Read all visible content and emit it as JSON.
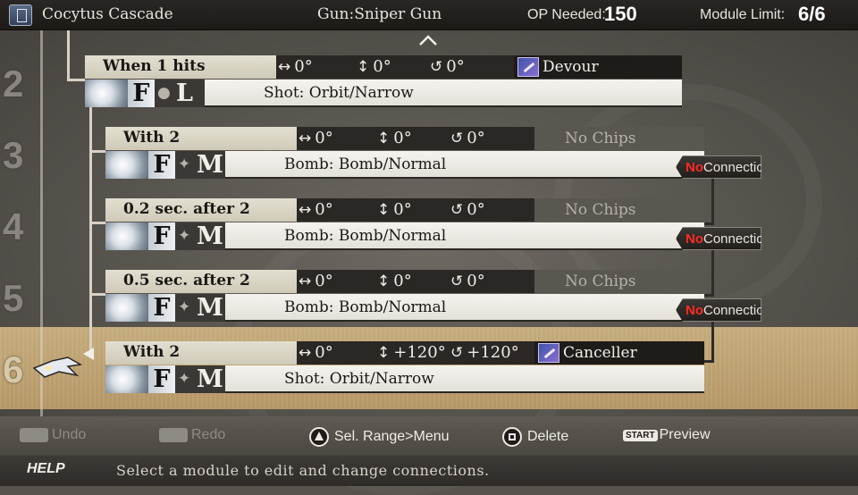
{
  "header": {
    "bullet_name": "Cocytus Cascade",
    "gun": "Gun:Sniper Gun",
    "op_label": "OP Needed:",
    "op_value": "150",
    "module_label": "Module  Limit:",
    "module_value": "6/6",
    "icon": "book-icon"
  },
  "rows": [
    {
      "num": "2",
      "trigger": "When 1 hits",
      "angle_h": "0°",
      "angle_v": "0°",
      "angle_r": "0°",
      "chip": "Devour",
      "chip_set": true,
      "element": "F",
      "letter": "L",
      "shot": "Shot: Orbit/Narrow",
      "connection": null
    },
    {
      "num": "3",
      "trigger": "With 2",
      "angle_h": "0°",
      "angle_v": "0°",
      "angle_r": "0°",
      "chip": "No Chips",
      "chip_set": false,
      "element": "F",
      "letter": "M",
      "shot": "Bomb: Bomb/Normal",
      "connection": {
        "no": "No",
        "text": "Connection"
      }
    },
    {
      "num": "4",
      "trigger": "0.2 sec. after 2",
      "angle_h": "0°",
      "angle_v": "0°",
      "angle_r": "0°",
      "chip": "No Chips",
      "chip_set": false,
      "element": "F",
      "letter": "M",
      "shot": "Bomb: Bomb/Normal",
      "connection": {
        "no": "No",
        "text": "Connection"
      }
    },
    {
      "num": "5",
      "trigger": "0.5 sec. after 2",
      "angle_h": "0°",
      "angle_v": "0°",
      "angle_r": "0°",
      "chip": "No Chips",
      "chip_set": false,
      "element": "F",
      "letter": "M",
      "shot": "Bomb: Bomb/Normal",
      "connection": {
        "no": "No",
        "text": "Connection"
      }
    },
    {
      "num": "6",
      "trigger": "With 2",
      "angle_h": "0°",
      "angle_v": "+120°",
      "angle_r": "+120°",
      "chip": "Canceller",
      "chip_set": true,
      "element": "F",
      "letter": "M",
      "shot": "Shot: Orbit/Narrow",
      "connection": null,
      "selected": true
    }
  ],
  "buttons": {
    "undo": "Undo",
    "redo": "Redo",
    "select_range": "Sel. Range>Menu",
    "delete": "Delete",
    "start_label": "START",
    "preview": "Preview",
    "l_label": "L",
    "r_label": "R"
  },
  "help": {
    "tag": "HELP",
    "text": "Select a module to edit and change connections."
  },
  "colors": {
    "selection": "#c4ab7c",
    "no_connection_red": "#ff2a22",
    "topbar": "#1c1917"
  }
}
